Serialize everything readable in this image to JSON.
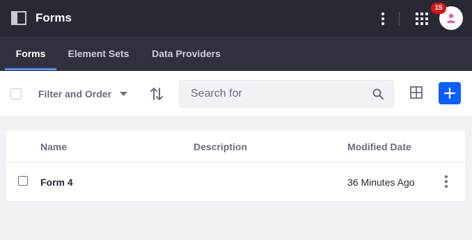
{
  "header": {
    "title": "Forms",
    "notification_count": "15",
    "icons": [
      "product-menu-icon",
      "kebab-icon",
      "apps-grid-icon",
      "user-icon"
    ]
  },
  "nav": {
    "tabs": [
      {
        "label": "Forms",
        "active": true
      },
      {
        "label": "Element Sets",
        "active": false
      },
      {
        "label": "Data Providers",
        "active": false
      }
    ]
  },
  "toolbar": {
    "filter_label": "Filter and Order",
    "search": {
      "placeholder": "Search for",
      "value": ""
    },
    "icons": [
      "sort-icon",
      "search-icon",
      "cards-view-icon",
      "plus-icon"
    ]
  },
  "table": {
    "columns": [
      "Name",
      "Description",
      "Modified Date"
    ],
    "rows": [
      {
        "name": "Form 4",
        "description": "",
        "modified": "36 Minutes Ago"
      }
    ]
  },
  "colors": {
    "header_bg": "#282934",
    "nav_bg": "#30313f",
    "accent": "#0b5fff",
    "tab_indicator": "#528eff",
    "badge": "#da1414",
    "avatar_icon": "#e8609a"
  }
}
